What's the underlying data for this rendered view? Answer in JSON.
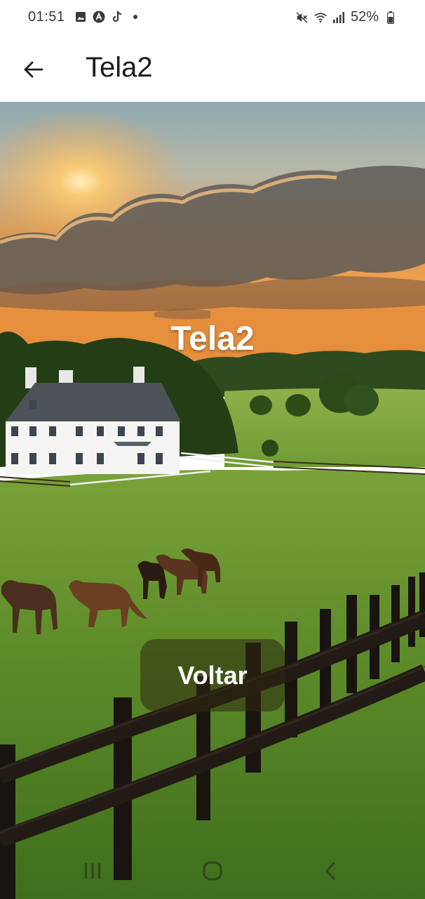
{
  "status_bar": {
    "time": "01:51",
    "battery": "52%",
    "left_icons": [
      "gallery-icon",
      "app-a-icon",
      "tiktok-icon",
      "dot-icon"
    ],
    "right_icons": [
      "mute-icon",
      "wifi-icon",
      "signal-icon",
      "battery-icon"
    ]
  },
  "app_bar": {
    "title": "Tela2",
    "back_icon": "arrow-back-icon"
  },
  "content": {
    "heading": "Tela2",
    "button_label": "Voltar"
  },
  "navigation_bar": {
    "buttons": [
      "recent-apps-icon",
      "home-icon",
      "back-icon"
    ]
  },
  "colors": {
    "sky_top": "#9fb3b8",
    "sunset": "#f2a04a",
    "grass": "#5e8f2a",
    "fence": "#1a1410",
    "button_bg": "#2d280f"
  }
}
